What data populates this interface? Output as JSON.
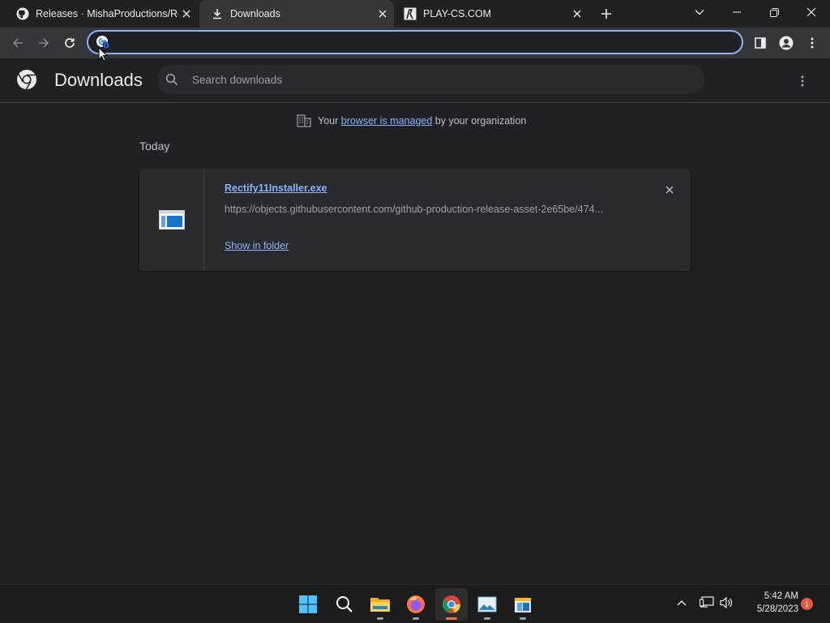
{
  "tabs": [
    {
      "title": "Releases · MishaProductions/Rec",
      "icon": "github-icon",
      "active": false
    },
    {
      "title": "Downloads",
      "icon": "download-icon",
      "active": true
    },
    {
      "title": "PLAY-CS.COM",
      "icon": "play-cs-icon",
      "active": false
    }
  ],
  "omnibox": {
    "value": "",
    "placeholder": ""
  },
  "downloads_page": {
    "title": "Downloads",
    "search_placeholder": "Search downloads",
    "managed": {
      "prefix": "Your",
      "link": "browser is managed",
      "suffix": "by your organization"
    },
    "section_label": "Today",
    "items": [
      {
        "filename": "Rectify11Installer.exe",
        "url": "https://objects.githubusercontent.com/github-production-release-asset-2e65be/474...",
        "action": "Show in folder"
      }
    ]
  },
  "taskbar": {
    "apps": [
      "start-icon",
      "search-icon",
      "file-explorer-icon",
      "firefox-icon",
      "chrome-icon",
      "photos-icon",
      "installer-icon"
    ],
    "time": "5:42 AM",
    "date": "5/28/2023",
    "notifications": "1"
  },
  "colors": {
    "accent": "#8ab4f8",
    "background": "#202124",
    "toolbar": "#35363a"
  }
}
